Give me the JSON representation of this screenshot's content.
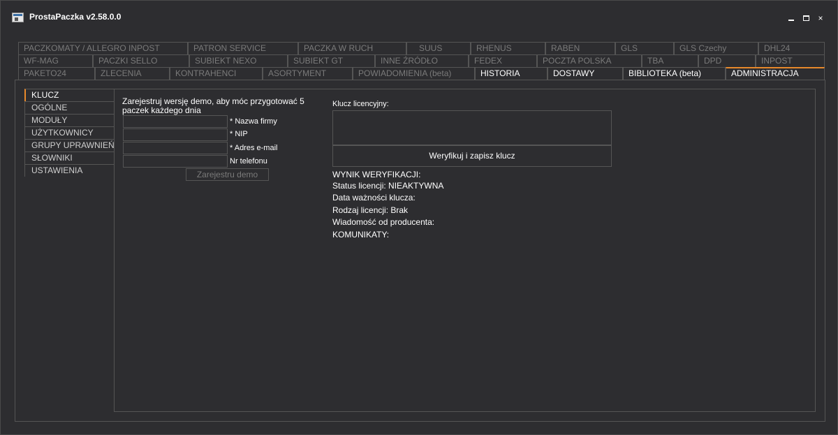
{
  "window": {
    "title": "ProstaPaczka v2.58.0.0",
    "icon": "app-window-icon",
    "controls": {
      "minimize": "minimize-icon",
      "maximize": "maximize-icon",
      "close": "×"
    }
  },
  "colors": {
    "background": "#2d2d30",
    "accent": "#e8892b",
    "border": "#555555",
    "dim_text": "#7a7a7a"
  },
  "tabs": {
    "row1": [
      {
        "label": "PACZKOMATY / ALLEGRO INPOST"
      },
      {
        "label": "PATRON SERVICE"
      },
      {
        "label": "PACZKA W RUCH"
      },
      {
        "label": "SUUS"
      },
      {
        "label": "RHENUS"
      },
      {
        "label": "RABEN"
      },
      {
        "label": "GLS"
      },
      {
        "label": "GLS Czechy"
      },
      {
        "label": "DHL24"
      }
    ],
    "row2": [
      {
        "label": "WF-MAG"
      },
      {
        "label": "PACZKI SELLO"
      },
      {
        "label": "SUBIEKT NEXO"
      },
      {
        "label": "SUBIEKT GT"
      },
      {
        "label": "INNE ŹRÓDŁO"
      },
      {
        "label": "FEDEX"
      },
      {
        "label": "POCZTA POLSKA"
      },
      {
        "label": "TBA"
      },
      {
        "label": "DPD"
      },
      {
        "label": "INPOST"
      }
    ],
    "row3": [
      {
        "label": "PAKETO24"
      },
      {
        "label": "ZLECENIA"
      },
      {
        "label": "KONTRAHENCI"
      },
      {
        "label": "ASORTYMENT"
      },
      {
        "label": "POWIADOMIENIA (beta)"
      },
      {
        "label": "HISTORIA"
      },
      {
        "label": "DOSTAWY"
      },
      {
        "label": "BIBLIOTEKA (beta)"
      },
      {
        "label": "ADMINISTRACJA"
      }
    ],
    "active": "ADMINISTRACJA"
  },
  "sidebar": {
    "items": [
      {
        "label": "KLUCZ"
      },
      {
        "label": "OGÓLNE"
      },
      {
        "label": "MODUŁY"
      },
      {
        "label": "UŻYTKOWNICY"
      },
      {
        "label": "GRUPY UPRAWNIEŃ"
      },
      {
        "label": "SŁOWNIKI"
      },
      {
        "label": "USTAWIENIA"
      }
    ],
    "active": "KLUCZ"
  },
  "demo": {
    "intro": "Zarejestruj wersję demo, aby móc przygotować 5 paczek każdego dnia",
    "fields": [
      {
        "label": "* Nazwa firmy",
        "value": ""
      },
      {
        "label": "* NIP",
        "value": ""
      },
      {
        "label": "* Adres e-mail",
        "value": ""
      },
      {
        "label": "Nr telefonu",
        "value": ""
      }
    ],
    "button": "Zarejestru demo"
  },
  "license": {
    "label": "Klucz licencyjny:",
    "value": "",
    "verify_button": "Weryfikuj i zapisz klucz",
    "results": {
      "heading": "WYNIK WERYFIKACJI:",
      "status": "Status licencji: NIEAKTYWNA",
      "expiry": "Data ważności klucza:",
      "type": "Rodzaj licencji: Brak",
      "message": "Wiadomość od producenta:",
      "notices": "KOMUNIKATY:"
    }
  }
}
